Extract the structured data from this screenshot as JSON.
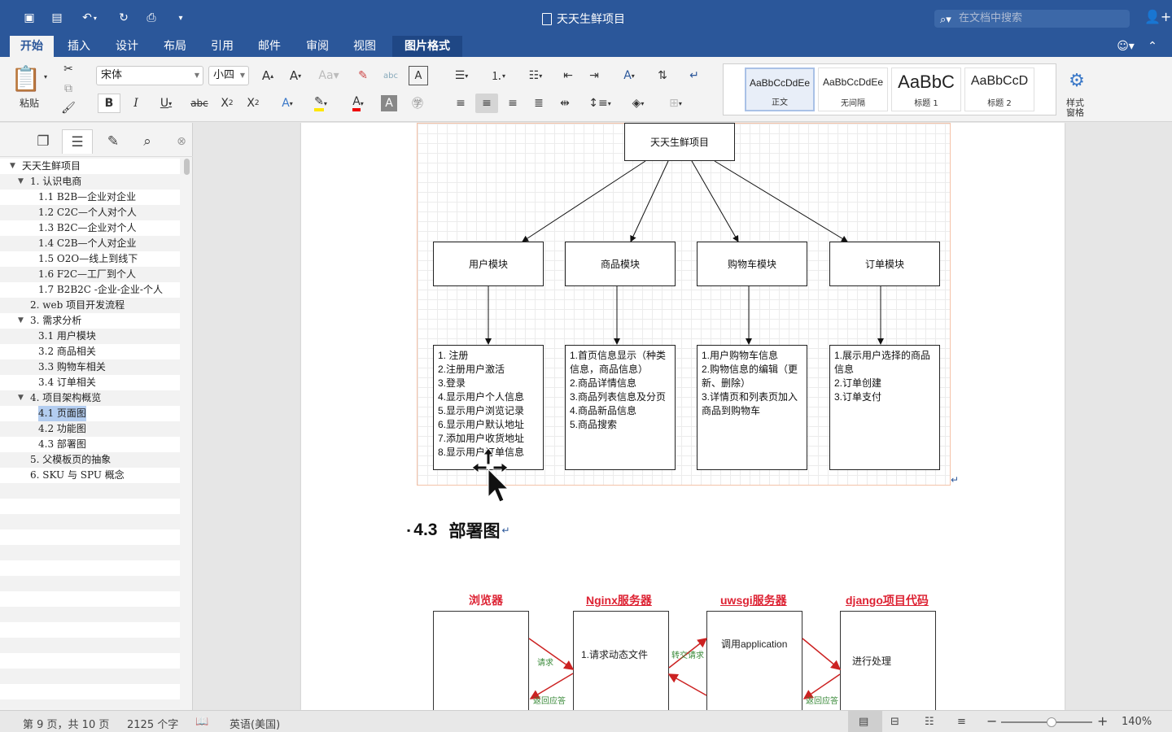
{
  "titlebar": {
    "title": "天天生鲜项目",
    "search_placeholder": "在文档中搜索"
  },
  "tabs": [
    {
      "label": "开始",
      "active": true
    },
    {
      "label": "插入"
    },
    {
      "label": "设计"
    },
    {
      "label": "布局"
    },
    {
      "label": "引用"
    },
    {
      "label": "邮件"
    },
    {
      "label": "审阅"
    },
    {
      "label": "视图"
    },
    {
      "label": "图片格式",
      "contextual": true
    }
  ],
  "ribbon": {
    "paste_label": "粘贴",
    "font_name": "宋体",
    "font_size": "小四",
    "styles_pane_label": "样式\n窗格",
    "styles": [
      {
        "sample": "AaBbCcDdEe",
        "label": "正文"
      },
      {
        "sample": "AaBbCcDdEe",
        "label": "无间隔"
      },
      {
        "sample": "AaBbC",
        "label": "标题 1"
      },
      {
        "sample": "AaBbCcD",
        "label": "标题 2"
      }
    ]
  },
  "nav": {
    "items": [
      {
        "text": "天天生鲜项目",
        "level": 0,
        "expanded": true
      },
      {
        "text": "1. 认识电商",
        "level": 1,
        "expanded": true
      },
      {
        "text": "1.1 B2B—企业对企业",
        "level": 2
      },
      {
        "text": "1.2 C2C—个人对个人",
        "level": 2
      },
      {
        "text": "1.3 B2C—企业对个人",
        "level": 2
      },
      {
        "text": "1.4 C2B—个人对企业",
        "level": 2
      },
      {
        "text": "1.5 O2O—线上到线下",
        "level": 2
      },
      {
        "text": "1.6 F2C—工厂到个人",
        "level": 2
      },
      {
        "text": "1.7 B2B2C -企业-企业-个人",
        "level": 2
      },
      {
        "text": "2. web 项目开发流程",
        "level": 1
      },
      {
        "text": "3. 需求分析",
        "level": 1,
        "expanded": true
      },
      {
        "text": "3.1 用户模块",
        "level": 2
      },
      {
        "text": "3.2 商品相关",
        "level": 2
      },
      {
        "text": "3.3 购物车相关",
        "level": 2
      },
      {
        "text": "3.4 订单相关",
        "level": 2
      },
      {
        "text": "4. 项目架构概览",
        "level": 1,
        "expanded": true
      },
      {
        "text": "4.1 页面图",
        "level": 2,
        "selected": true
      },
      {
        "text": "4.2 功能图",
        "level": 2
      },
      {
        "text": "4.3 部署图",
        "level": 2
      },
      {
        "text": "5. 父模板页的抽象",
        "level": 1
      },
      {
        "text": "6. SKU 与 SPU 概念",
        "level": 1
      }
    ]
  },
  "document": {
    "diagram": {
      "root": "天天生鲜项目",
      "modules": [
        "用户模块",
        "商品模块",
        "购物车模块",
        "订单模块"
      ],
      "details": [
        "1. 注册\n2.注册用户激活\n3.登录\n4.显示用户个人信息\n5.显示用户浏览记录\n6.显示用户默认地址\n7.添加用户收货地址\n8.显示用户订单信息",
        "1.首页信息显示（种类\n信息，商品信息）\n2.商品详情信息\n3.商品列表信息及分页\n4.商品新品信息\n5.商品搜索",
        "1.用户购物车信息\n2.购物信息的编辑（更\n新、删除）\n3.详情页和列表页加入\n商品到购物车",
        "1.展示用户选择的商品\n信息\n2.订单创建\n3.订单支付"
      ]
    },
    "heading_number": "4.3",
    "heading_text": "部署图",
    "deployment": {
      "labels": [
        "浏览器",
        "Nginx服务器",
        "uwsgi服务器",
        "django项目代码"
      ],
      "box_texts": [
        "",
        "1.请求动态文件",
        "调用application",
        "进行处理"
      ],
      "arrows": [
        "请求",
        "返回应答",
        "转交请求",
        "返回应答"
      ]
    }
  },
  "status": {
    "page": "第 9 页，共 10 页",
    "words": "2125 个字",
    "language": "英语(美国)",
    "zoom": "140%",
    "zoom_level": 0.55
  },
  "colors": {
    "brand": "#2b579a",
    "accent_red": "#d23",
    "arrow_green": "#3a8a3a"
  }
}
